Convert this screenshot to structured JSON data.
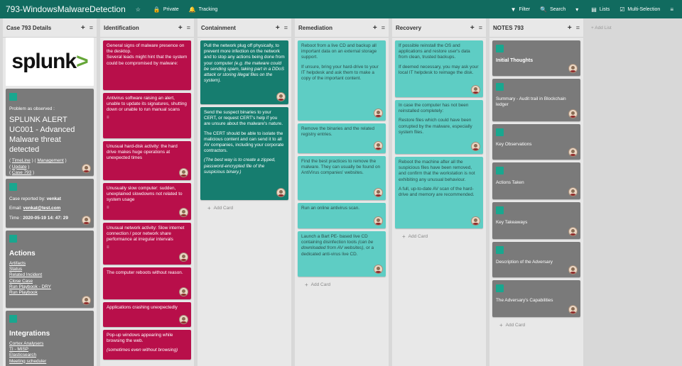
{
  "header": {
    "title": "793-WindowsMalwareDetection",
    "private": "Private",
    "tracking": "Tracking",
    "filter": "Filter",
    "search": "Search",
    "lists": "Lists",
    "multiselect": "Multi-Selection"
  },
  "lists": [
    {
      "title": "Case 793 Details"
    },
    {
      "title": "Identification"
    },
    {
      "title": "Containment"
    },
    {
      "title": "Remediation"
    },
    {
      "title": "Recovery"
    },
    {
      "title": "NOTES 793"
    }
  ],
  "add_card": "Add Card",
  "add_list": "Add List",
  "case": {
    "logo": "splunk",
    "problem_label": "Problem as observed :",
    "alert": "SPLUNK ALERT UC001 - Advanced Malware threat detected",
    "link_timeline": "TimeLine",
    "link_management": "Management",
    "link_update": "Update",
    "link_case": "Case 793",
    "reported_label": "Case reported by:",
    "reported_by": "venkat",
    "email_label": "Email:",
    "email": "venkat@test.com",
    "time_label": "Time :",
    "time": "2020-05-19 14: 47: 29",
    "actions_title": "Actions",
    "actions": [
      "Artifacts",
      "Status",
      "Related Incident",
      "Close Case",
      "Run Playbook - DRY",
      "Run Playbook"
    ],
    "integrations_title": "Integrations",
    "integrations": [
      "Cortex Analysers",
      "TI - MISP",
      "Elasticsearch",
      "Meeting scheduler"
    ]
  },
  "identification": [
    "General signs of malware presence on the desktop.\nSeveral leads might hint that the system could be compromised by malware:",
    "Antivirus software raising an alert, unable to update its signatures, shutting down or unable to run manual scans",
    "Unusual hard-disk activity: the hard drive makes huge operations at unexpected times",
    "Unusually slow computer: sudden, unexplained slowdowns not related to system usage",
    "Unusual network activity: Slow internet connection / poor network share performance at irregular intervals",
    "The computer reboots without reason.",
    "Applications crashing unexpectedly",
    "Pop-up windows appearing while browsing the web.",
    "(sometimes even without browsing)"
  ],
  "containment": {
    "c1_a": "Pull the network plug off physically, to prevent more infection on the network and to stop any actions being done from your computer",
    "c1_b": "(e.g. the malware could be sending spam, taking part in a DDoS attack or storing illegal files on the system).",
    "c2_a": "Send the suspect binaries to your CERT, or request CERT's help if you are unsure about the malware's nature.",
    "c2_b": "The CERT should be able to isolate the malicious content and can send it to all AV companies, including your corporate contractors.",
    "c2_c": "(The best way is to create a zipped, password-encrypted file of the suspicious binary.)"
  },
  "remediation": {
    "r1": "Reboot from a live CD and backup all important data on an external storage support.",
    "r1b": "If unsure, bring your hard-drive to your IT helpdesk and ask them to make a copy of the important content.",
    "r2": "Remove the binaries and the related registry entries.",
    "r3": "Find the best practices to remove the malware. They can usually be found on AntiVirus companies' websites.",
    "r4": "Run an online antivirus scan.",
    "r5a": "Launch a Bart PE- based live CD containing disinfection tools",
    "r5b": "(can be downloaded from AV websites),",
    "r5c": "or a dedicated anti-virus live CD."
  },
  "recovery": {
    "v1": "If possible reinstall the OS and applications and restore user's data from clean, trusted backups.",
    "v1b": "If deemed necessary, you may ask your local IT helpdesk to reimage the disk.",
    "v2": "In case the computer has not been reinstalled completely:",
    "v2b": "Restore files which could have been corrupted by the malware, especially system files.",
    "v3": "Reboot the machine after all the suspicious files have been removed, and confirm that the workstation is not exhibiting any unusual behaviour.",
    "v3b": "A full, up-to-date AV scan of the hard-drive and memory are recommended."
  },
  "notes": [
    "Initial Thoughts",
    "Summary - Audit trail in Blockchain ledger",
    "Key Observations",
    "Actions Taken",
    "Key Takeaways",
    "Description of the Adversary",
    "The Adversary's Capabilities"
  ]
}
